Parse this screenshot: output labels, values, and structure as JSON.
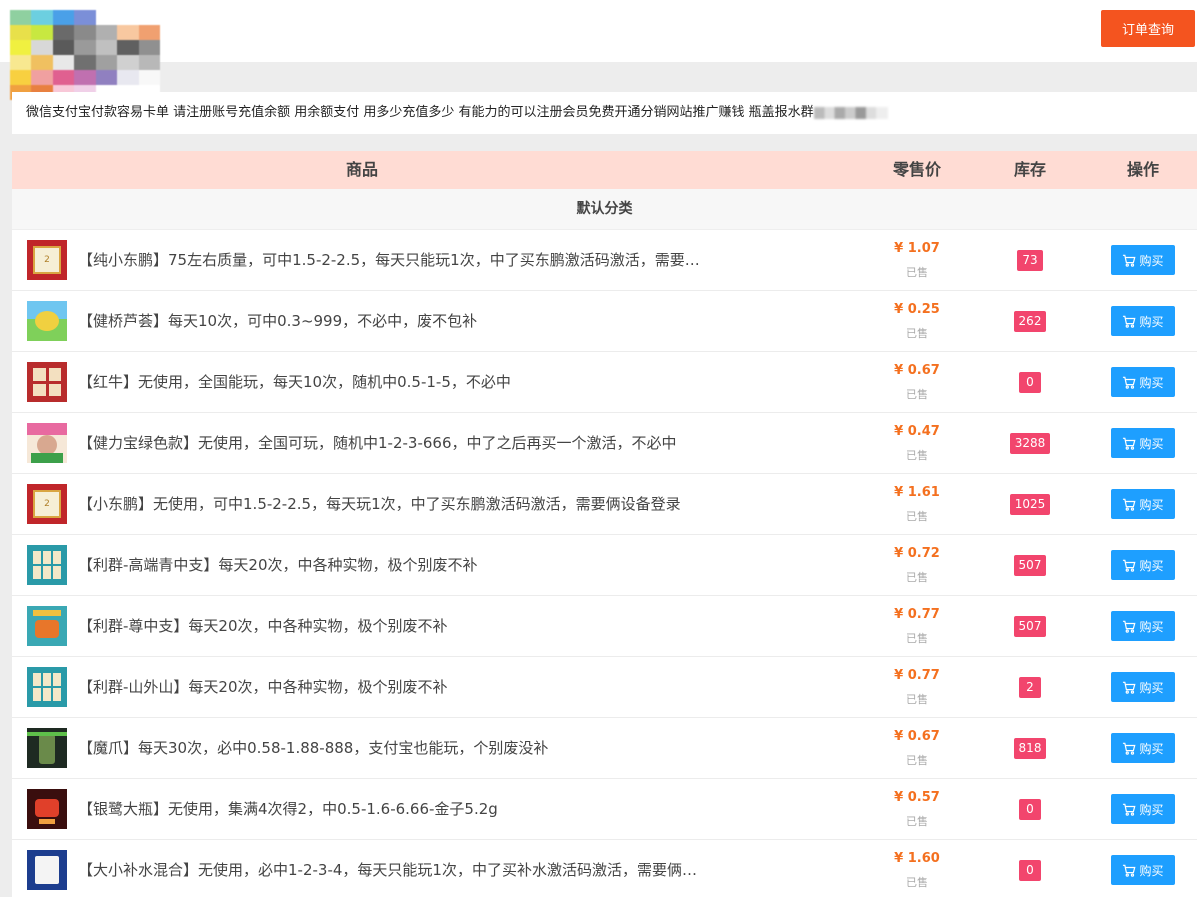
{
  "header": {
    "order_query_label": "订单查询",
    "accent_color": "#f4541f"
  },
  "notice": {
    "text": "微信支付宝付款容易卡单 请注册账号充值余额 用余额支付 用多少充值多少 有能力的可以注册会员免费开通分销网站推广赚钱 瓶盖报水群"
  },
  "table": {
    "columns": [
      "商品",
      "零售价",
      "库存",
      "操作"
    ],
    "category": "默认分类",
    "buy_label": "购买",
    "sold_label": "已售",
    "rows": [
      {
        "name": "【纯小东鹏】75左右质量，可中1.5-2-2.5，每天只能玩1次，中了买东鹏激活码激活，需要俩设备",
        "price": "¥ 1.07",
        "stock": "73",
        "thumb": "red-card"
      },
      {
        "name": "【健桥芦荟】每天10次，可中0.3~999，不必中，废不包补",
        "price": "¥ 0.25",
        "stock": "262",
        "thumb": "aloe"
      },
      {
        "name": "【红牛】无使用，全国能玩，每天10次，随机中0.5-1-5，不必中",
        "price": "¥ 0.67",
        "stock": "0",
        "thumb": "redbull"
      },
      {
        "name": "【健力宝绿色款】无使用，全国可玩，随机中1-2-3-666，中了之后再买一个激活，不必中",
        "price": "¥ 0.47",
        "stock": "3288",
        "thumb": "person"
      },
      {
        "name": "【小东鹏】无使用，可中1.5-2-2.5，每天玩1次，中了买东鹏激活码激活，需要俩设备登录",
        "price": "¥ 1.61",
        "stock": "1025",
        "thumb": "red-card"
      },
      {
        "name": "【利群-高端青中支】每天20次，中各种实物，极个别废不补",
        "price": "¥ 0.72",
        "stock": "507",
        "thumb": "teal-grid"
      },
      {
        "name": "【利群-尊中支】每天20次，中各种实物，极个别废不补",
        "price": "¥ 0.77",
        "stock": "507",
        "thumb": "teal-orange"
      },
      {
        "name": "【利群-山外山】每天20次，中各种实物，极个别废不补",
        "price": "¥ 0.77",
        "stock": "2",
        "thumb": "teal-grid"
      },
      {
        "name": "【魔爪】每天30次，必中0.58-1.88-888，支付宝也能玩，个别废没补",
        "price": "¥ 0.67",
        "stock": "818",
        "thumb": "dark-green"
      },
      {
        "name": "【银鹭大瓶】无使用，集满4次得2，中0.5-1.6-6.66-金子5.2g",
        "price": "¥ 0.57",
        "stock": "0",
        "thumb": "dark-red"
      },
      {
        "name": "【大小补水混合】无使用，必中1-2-3-4，每天只能玩1次，中了买补水激活码激活，需要俩设备",
        "price": "¥ 1.60",
        "stock": "0",
        "thumb": "blue-card"
      }
    ]
  }
}
